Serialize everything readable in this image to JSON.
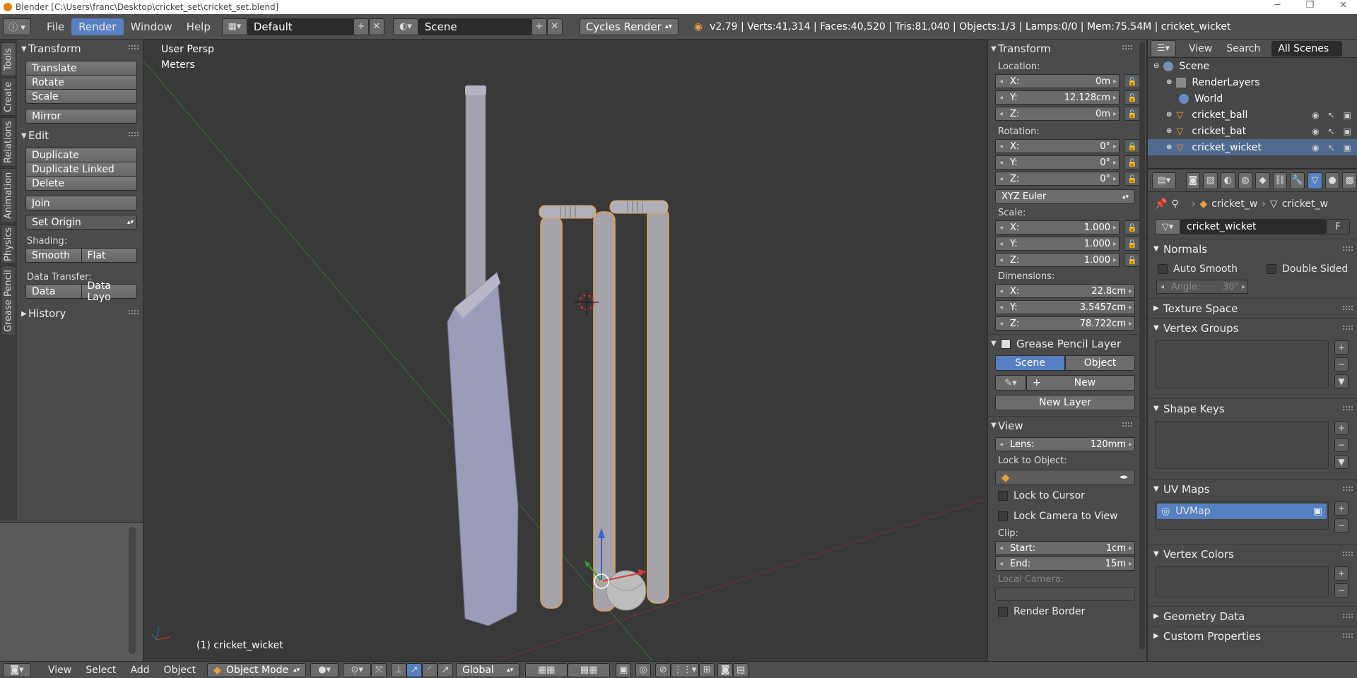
{
  "window_title": "Blender [C:\\Users\\franc\\Desktop\\cricket_set\\cricket_set.blend]",
  "topbar": {
    "menus": [
      "File",
      "Render",
      "Window",
      "Help"
    ],
    "active_menu": "Render",
    "layout": "Default",
    "scene": "Scene",
    "engine": "Cycles Render",
    "stats": "v2.79 | Verts:41,314 | Faces:40,520 | Tris:81,040 | Objects:1/3 | Lamps:0/0 | Mem:75.54M | cricket_wicket"
  },
  "left_tabs": [
    "Tools",
    "Create",
    "Relations",
    "Animation",
    "Physics",
    "Grease Pencil"
  ],
  "toolshelf": {
    "transform_title": "Transform",
    "translate": "Translate",
    "rotate": "Rotate",
    "scale": "Scale",
    "mirror": "Mirror",
    "edit_title": "Edit",
    "duplicate": "Duplicate",
    "duplicate_linked": "Duplicate Linked",
    "delete": "Delete",
    "join": "Join",
    "set_origin": "Set Origin",
    "shading_label": "Shading:",
    "smooth": "Smooth",
    "flat": "Flat",
    "data_transfer_label": "Data Transfer:",
    "data": "Data",
    "data_layout": "Data Layo",
    "history_title": "History"
  },
  "viewport": {
    "persp": "User Persp",
    "units": "Meters",
    "active_object": "(1) cricket_wicket"
  },
  "npanel": {
    "transform_title": "Transform",
    "location_label": "Location:",
    "location": [
      {
        "axis": "X:",
        "value": "0m"
      },
      {
        "axis": "Y:",
        "value": "12.128cm"
      },
      {
        "axis": "Z:",
        "value": "0m"
      }
    ],
    "rotation_label": "Rotation:",
    "rotation": [
      {
        "axis": "X:",
        "value": "0°"
      },
      {
        "axis": "Y:",
        "value": "0°"
      },
      {
        "axis": "Z:",
        "value": "0°"
      }
    ],
    "rotation_mode": "XYZ Euler",
    "scale_label": "Scale:",
    "scale": [
      {
        "axis": "X:",
        "value": "1.000"
      },
      {
        "axis": "Y:",
        "value": "1.000"
      },
      {
        "axis": "Z:",
        "value": "1.000"
      }
    ],
    "dimensions_label": "Dimensions:",
    "dimensions": [
      {
        "axis": "X:",
        "value": "22.8cm"
      },
      {
        "axis": "Y:",
        "value": "3.5457cm"
      },
      {
        "axis": "Z:",
        "value": "78.722cm"
      }
    ],
    "grease_title": "Grease Pencil Layer",
    "gp_scene": "Scene",
    "gp_object": "Object",
    "gp_new": "New",
    "gp_new_layer": "New Layer",
    "view_title": "View",
    "lens_label": "Lens:",
    "lens_value": "120mm",
    "lock_object_label": "Lock to Object:",
    "lock_cursor": "Lock to Cursor",
    "lock_camera": "Lock Camera to View",
    "clip_label": "Clip:",
    "clip_start_label": "Start:",
    "clip_start": "1cm",
    "clip_end_label": "End:",
    "clip_end": "15m",
    "local_camera": "Local Camera:",
    "render_border": "Render Border"
  },
  "outliner": {
    "view": "View",
    "search": "Search",
    "all_scenes": "All Scenes",
    "items": [
      "Scene",
      "RenderLayers",
      "World",
      "cricket_ball",
      "cricket_bat",
      "cricket_wicket"
    ]
  },
  "properties": {
    "breadcrumb_obj": "cricket_w",
    "breadcrumb_data": "cricket_w",
    "mesh_name": "cricket_wicket",
    "fake_user": "F",
    "normals_title": "Normals",
    "auto_smooth": "Auto Smooth",
    "double_sided": "Double Sided",
    "angle_label": "Angle:",
    "angle_value": "30°",
    "texture_space": "Texture Space",
    "vertex_groups": "Vertex Groups",
    "shape_keys": "Shape Keys",
    "uv_maps": "UV Maps",
    "uv_map_name": "UVMap",
    "vertex_colors": "Vertex Colors",
    "geometry_data": "Geometry Data",
    "custom_properties": "Custom Properties"
  },
  "bottombar": {
    "view": "View",
    "select": "Select",
    "add": "Add",
    "object": "Object",
    "mode": "Object Mode",
    "orientation": "Global"
  },
  "colors": {
    "accent": "#5680c2",
    "selection": "#e89a3c",
    "header": "#4f4f4f",
    "viewport_bg": "#393939"
  }
}
